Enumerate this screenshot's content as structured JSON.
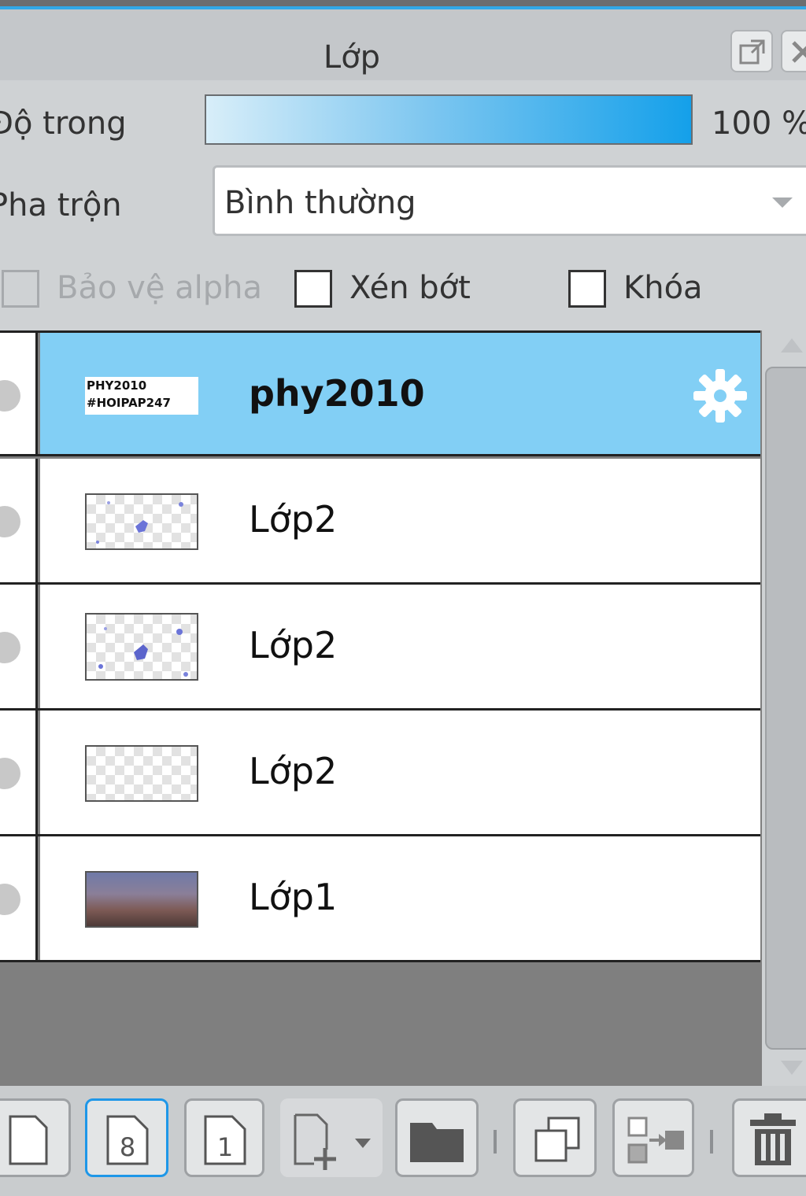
{
  "panel": {
    "title": "Lớp"
  },
  "opacity": {
    "label": "Độ trong",
    "value_text": "100 %",
    "value": 1.0
  },
  "blend": {
    "label": "Pha trộn",
    "selected": "Bình thường"
  },
  "options": {
    "protect_alpha": {
      "label": "Bảo vệ alpha",
      "checked": false,
      "disabled": true
    },
    "clip": {
      "label": "Xén bớt",
      "checked": false
    },
    "lock": {
      "label": "Khóa",
      "checked": false
    }
  },
  "layers": [
    {
      "name": "phy2010",
      "selected": true,
      "thumbnail": "text",
      "thumb_text": [
        "PHY2010",
        "#HOIPAP247"
      ]
    },
    {
      "name": "Lớp2",
      "selected": false,
      "thumbnail": "sparse-blue-marks"
    },
    {
      "name": "Lớp2",
      "selected": false,
      "thumbnail": "blue-marks"
    },
    {
      "name": "Lớp2",
      "selected": false,
      "thumbnail": "transparent"
    },
    {
      "name": "Lớp1",
      "selected": false,
      "thumbnail": "photo"
    }
  ],
  "toolbar": {
    "buttons": [
      "new-layer-icon",
      "new-8bit-layer-icon",
      "new-1bit-layer-icon",
      "add-layer-menu-icon",
      "new-folder-icon",
      "duplicate-layer-icon",
      "merge-down-icon",
      "delete-icon"
    ],
    "bit8_label": "8",
    "bit1_label": "1"
  },
  "colors": {
    "accent": "#31a8e8",
    "selected_row": "#82cff5",
    "opacity_bar_end": "#14a0ea"
  }
}
